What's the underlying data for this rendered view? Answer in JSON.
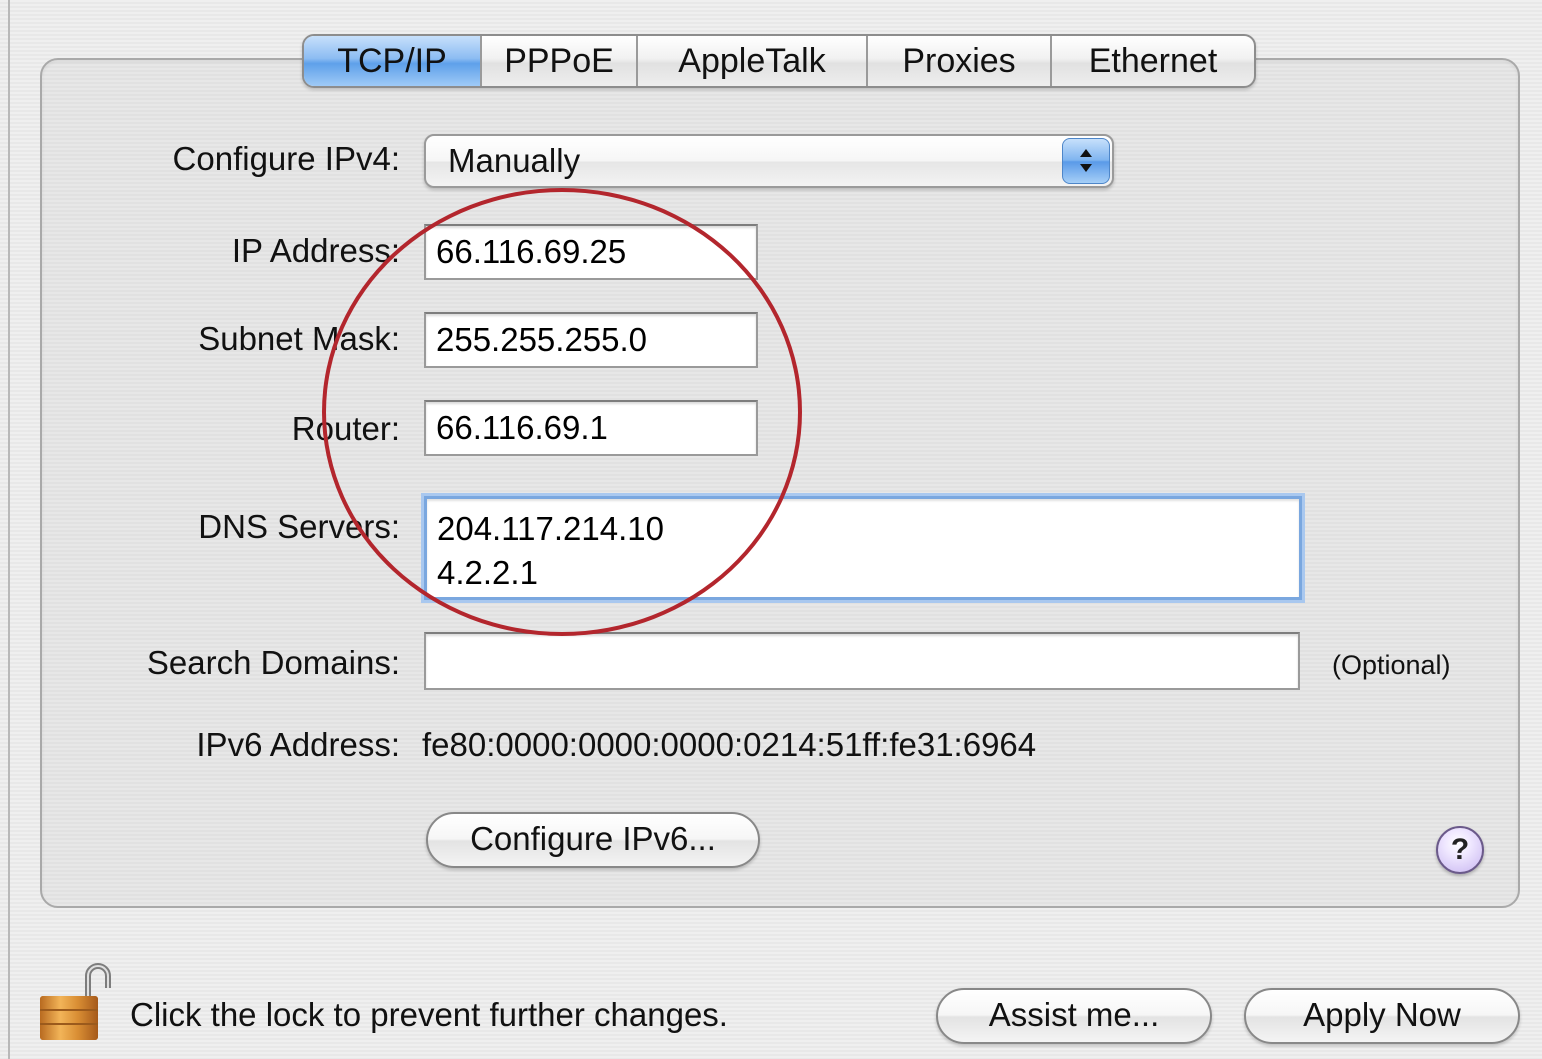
{
  "tabs": [
    {
      "label": "TCP/IP",
      "active": true
    },
    {
      "label": "PPPoE",
      "active": false
    },
    {
      "label": "AppleTalk",
      "active": false
    },
    {
      "label": "Proxies",
      "active": false
    },
    {
      "label": "Ethernet",
      "active": false
    }
  ],
  "configure_ipv4": {
    "label": "Configure IPv4:",
    "value": "Manually"
  },
  "ip_address": {
    "label": "IP Address:",
    "value": "66.116.69.25"
  },
  "subnet_mask": {
    "label": "Subnet Mask:",
    "value": "255.255.255.0"
  },
  "router": {
    "label": "Router:",
    "value": "66.116.69.1"
  },
  "dns_servers": {
    "label": "DNS Servers:",
    "value": "204.117.214.10\n4.2.2.1"
  },
  "search_domains": {
    "label": "Search Domains:",
    "value": "",
    "hint": "(Optional)"
  },
  "ipv6_address": {
    "label": "IPv6 Address:",
    "value": "fe80:0000:0000:0000:0214:51ff:fe31:6964"
  },
  "configure_ipv6_button": "Configure IPv6...",
  "help_button": "?",
  "lock_message": "Click the lock to prevent further changes.",
  "assist_button": "Assist me...",
  "apply_button": "Apply Now",
  "colors": {
    "annotation_circle": "#b3262d",
    "active_tab": "#5ea0ea",
    "focus_ring": "#7aa7df"
  }
}
